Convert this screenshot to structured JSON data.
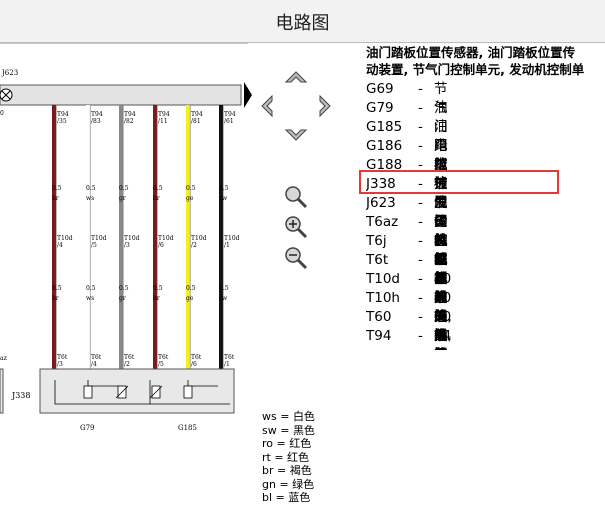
{
  "window": {
    "title": "电路图"
  },
  "legend": {
    "heading_line1": "油门踏板位置传感器, 油门踏板位置传",
    "heading_line2": "动装置, 节气门控制单元, 发动机控制单",
    "items": [
      {
        "code": "G69",
        "dash": "-",
        "desc": "节气门电位计"
      },
      {
        "code": "G79",
        "dash": "-",
        "desc": "油门踏板位置传感器"
      },
      {
        "code": "G185",
        "dash": "-",
        "desc": "油门踏板位置传感器 2"
      },
      {
        "code": "G186",
        "dash": "-",
        "desc": "电控油门操纵机构的节气门"
      },
      {
        "code": "G188",
        "dash": "-",
        "desc": "电控油门操纵机构的节气门"
      },
      {
        "code": "J338",
        "dash": "-",
        "desc": "节气门控制单元"
      },
      {
        "code": "J623",
        "dash": "-",
        "desc": "发动机控制单元, 电控箱内"
      },
      {
        "code": "T6az",
        "dash": "-",
        "desc": "6 芯插头连接, 黑色"
      },
      {
        "code": "T6j",
        "dash": "-",
        "desc": "6 芯插头连接, 红色, 驾驶员"
      },
      {
        "code": "T6t",
        "dash": "-",
        "desc": "6 芯插头连接, 黑色"
      },
      {
        "code": "T10d",
        "dash": "-",
        "desc": "10 芯插头连接, 蓝色, 发动机"
      },
      {
        "code": "T10h",
        "dash": "-",
        "desc": "10 芯插头连接, 橙色, 发动机"
      },
      {
        "code": "T60",
        "dash": "-",
        "desc": "60 芯插头连接, 黑色"
      },
      {
        "code": "T94",
        "dash": "-",
        "desc": "94 芯插头连接, 黑色"
      }
    ]
  },
  "color_key": [
    "ws = 白色",
    "sw = 黑色",
    "ro = 红色",
    "rt = 红色",
    "br = 褐色",
    "gn = 绿色",
    "bl = 蓝色"
  ],
  "diagram": {
    "module_top": "J623",
    "module_bottom": "J338",
    "sensor_left": "G79",
    "sensor_right": "G185",
    "left_edge_top": "0",
    "left_edge_bottom": "az",
    "wires": [
      {
        "color": "#7a1a1a",
        "pin": "T94",
        "num": "/35",
        "size": "0.5",
        "code": "br",
        "conn": "T10d",
        "cpin": "/4",
        "bottom": "T6t",
        "bpin": "/3"
      },
      {
        "color": "#ffffff",
        "pin": "T94",
        "num": "/83",
        "size": "0.5",
        "code": "ws",
        "conn": "T10d",
        "cpin": "/5",
        "bottom": "T6t",
        "bpin": "/4"
      },
      {
        "color": "#888888",
        "pin": "T94",
        "num": "/82",
        "size": "0.5",
        "code": "gr",
        "conn": "T10d",
        "cpin": "/3",
        "bottom": "T6t",
        "bpin": "/2"
      },
      {
        "color": "#7a1a1a",
        "pin": "T94",
        "num": "/11",
        "size": "0.5",
        "code": "br",
        "conn": "T10d",
        "cpin": "/6",
        "bottom": "T6t",
        "bpin": "/5"
      },
      {
        "color": "#f5f01a",
        "pin": "T94",
        "num": "/81",
        "size": "0.5",
        "code": "ge",
        "conn": "T10d",
        "cpin": "/2",
        "bottom": "T6t",
        "bpin": "/6"
      },
      {
        "color": "#111111",
        "pin": "T94",
        "num": "/61",
        "size": "0.5",
        "code": "sw",
        "conn": "T10d",
        "cpin": "/1",
        "bottom": "T6t",
        "bpin": "/1"
      }
    ]
  }
}
